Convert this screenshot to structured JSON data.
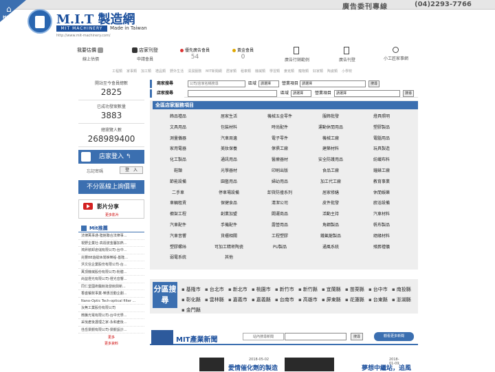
{
  "top": {
    "home_label": "HOME",
    "ad_text": "廣告委刊專線",
    "ad_phone": "(04)2293-7766"
  },
  "brand": {
    "name": "M.I.T 製造網",
    "bar": "MIT MACHINERY",
    "made": "Made in Taiwan",
    "url": "http://www.mit-machinery.com/"
  },
  "nav": [
    {
      "label": "我要估價",
      "sub": "線上估價",
      "num": ""
    },
    {
      "label": "店家刊登",
      "sub": "申請會員",
      "num": ""
    },
    {
      "label": "優先廣告會員",
      "sub": "",
      "num": "54"
    },
    {
      "label": "黃金會員",
      "sub": "",
      "num": "0"
    },
    {
      "label": "",
      "sub": "廣告行銷範例",
      "num": ""
    },
    {
      "label": "",
      "sub": "廣告刊登",
      "num": ""
    },
    {
      "label": "",
      "sub": "小工匠家事網",
      "num": ""
    }
  ],
  "categories": [
    "工程類",
    "家事類",
    "加工類",
    "禮品類",
    "野外生活",
    "清潔服務",
    "MIT新聞網",
    "居家類",
    "租車類",
    "機械類",
    "學習類",
    "麥克類",
    "寵物類",
    "好家類",
    "陶瓷類",
    "小學校"
  ],
  "stats": [
    {
      "label": "開站至今會員總數",
      "value": "2825"
    },
    {
      "label": "已成功發案數量",
      "value": "3883"
    },
    {
      "label": "總瀏覽人數",
      "value": "268989400"
    }
  ],
  "login": {
    "button": "店家登入",
    "forget": "忘記密碼",
    "submit": "登　入"
  },
  "price_button": "不分區線上詢價單",
  "film": {
    "title": "影片分享",
    "more": "更多影片"
  },
  "mit": {
    "title": "Mit推薦",
    "items": [
      "法律萬事通-陸館聯合法律事...",
      "視野企業社-高週波金屬加熱...",
      "鴻昇裝卸倉儲有限公司-台中...",
      "兆豐88遊艇休閒娛樂船-基隆...",
      "洪文信企業股份有限公司-台...",
      "萬頂機械股份有限公司-粉體...",
      "尚益燈光有限公司-燈光音響...",
      "同仁堂國術醫館批發館興新...",
      "香盛餐飲事業-樂惠活動企劃...",
      "Nano-Optic Tech-optical filter ...",
      "汝無工業股份有限公司",
      "微騰光電有限公司-台中光學...",
      "采悅產後護理之家-永和產後...",
      "佳岳景觀有限公司-景觀設計..."
    ],
    "more1": "更多",
    "more2": "更多資料"
  },
  "search": {
    "row1_tag": "商家搜尋",
    "row1_placeholder": "公司/店家名稱搜尋",
    "area_label": "區域",
    "area_value": "請選擇",
    "item_label": "營業項目",
    "item_value": "請選擇",
    "button": "搜尋",
    "row2_tag": "店家搜尋"
  },
  "services": {
    "title": "全區店家服務項目",
    "items": [
      "飾品禮品",
      "居家生活",
      "機械五金零件",
      "服飾批發",
      "燈具照明",
      "文具用品",
      "包裝材料",
      "時尚配件",
      "運動休閒用品",
      "塑膠製品",
      "測量儀器",
      "汽車周邊",
      "電子零件",
      "機械工廠",
      "電腦用品",
      "家用電器",
      "美妝保養",
      "傢俱工廠",
      "建築材料",
      "玩具製造",
      "化工製品",
      "通訊用品",
      "醫療器材",
      "安全防護用品",
      "紡織布料",
      "鞋類",
      "光學器材",
      "印刷出版",
      "食品工廠",
      "鐘錶工廠",
      "節能設備",
      "園藝用品",
      "婦幼用品",
      "加工代工廠",
      "教育事業",
      "二手車",
      "停車場設備",
      "卸貨防撞系列",
      "居家修繕",
      "休閒娛樂",
      "車輛租賃",
      "保健食品",
      "清潔公司",
      "皮件批發",
      "廚浴設備",
      "櫥架工程",
      "創業加盟",
      "閥運商品",
      "活動主持",
      "汽車材料",
      "汽車配件",
      "手機配件",
      "露營用品",
      "角鋼製品",
      "帆布製品",
      "汽車音響",
      "貨櫃相關",
      "工程塑膠",
      "鐵氟龍製品",
      "絕緣材料",
      "塑膠螺絲",
      "可加工精密陶瓷",
      "PU製品",
      "通風系統",
      "殯葬禮儀",
      "弱電系統",
      "其他"
    ]
  },
  "region": {
    "tag": "分區搜尋",
    "cities": [
      "基隆市",
      "台北市",
      "新北市",
      "桃園市",
      "新竹市",
      "新竹縣",
      "宜蘭縣",
      "苗栗縣",
      "台中市",
      "南投縣",
      "彰化縣",
      "雲林縣",
      "嘉義市",
      "嘉義縣",
      "台南市",
      "高雄市",
      "屏東縣",
      "花蓮縣",
      "台東縣",
      "澎湖縣",
      "金門縣"
    ]
  },
  "news": {
    "title": "MIT產業新聞",
    "search_label": "站內搜尋新聞",
    "search_button": "搜尋",
    "more": "觀看更多新聞",
    "cards": [
      {
        "date": "2018-05-02",
        "headline": "愛情催化劑的製造"
      },
      {
        "date": "2018-01-09",
        "headline": "夢想中繼站，追風"
      }
    ]
  }
}
